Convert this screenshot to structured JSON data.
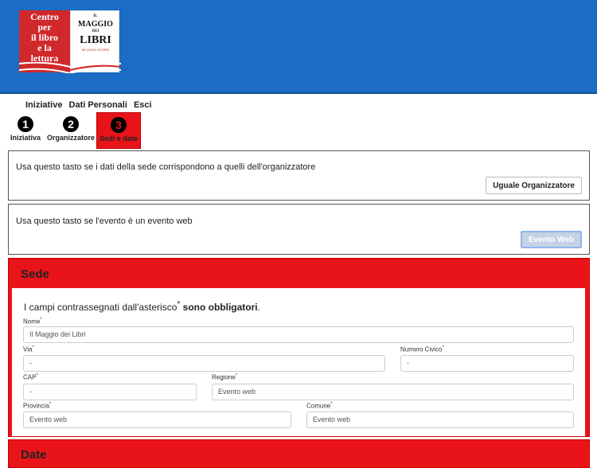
{
  "logo": {
    "red_text": [
      "Centro",
      "per",
      "il libro",
      "e la",
      "lettura"
    ],
    "book_small": "IL",
    "book_maggio": "MAGGIO",
    "book_dei": "DEI",
    "book_libri": "LIBRI",
    "book_sub": "SE LEGGI SCOPRI"
  },
  "nav": {
    "items": [
      "Iniziative",
      "Dati Personali",
      "Esci"
    ]
  },
  "steps": [
    {
      "num": "1",
      "label": "Iniziativa"
    },
    {
      "num": "2",
      "label": "Organizzatore"
    },
    {
      "num": "3",
      "label": "Sedi e date"
    }
  ],
  "panel_org": {
    "text": "Usa questo tasto se i dati della sede corrispondono a quelli dell'organizzatore",
    "button": "Uguale Organizzatore"
  },
  "panel_web": {
    "text": "Usa questo tasto se l'evento è un evento web",
    "button": "Evento Web"
  },
  "sede": {
    "title": "Sede",
    "note_prefix": "I campi contrassegnati dall'asterisco",
    "note_suffix": "sono obbligatori",
    "asterisk": "*",
    "fields": {
      "nome": {
        "label": "Nome",
        "value": "Il Maggio dei Libri"
      },
      "via": {
        "label": "Via",
        "value": "-"
      },
      "civico": {
        "label": "Numero Civico",
        "value": "-"
      },
      "cap": {
        "label": "CAP",
        "value": "-"
      },
      "regione": {
        "label": "Regione",
        "value": "Evento web"
      },
      "provincia": {
        "label": "Provincia",
        "value": "Evento web"
      },
      "comune": {
        "label": "Comune",
        "value": "Evento web"
      }
    }
  },
  "date": {
    "title": "Date"
  },
  "colors": {
    "header_blue": "#1a6cc4",
    "accent_red": "#e8141a"
  }
}
